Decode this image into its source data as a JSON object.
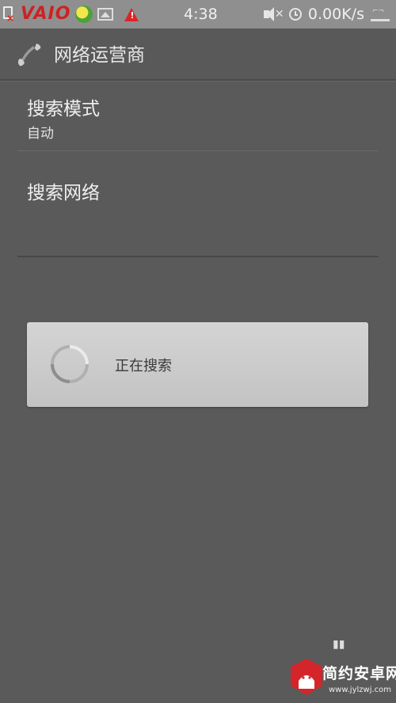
{
  "status_bar": {
    "brand": "VAIO",
    "time": "4:38",
    "net_speed": "0.00K/s",
    "icons": [
      "sim-error-icon",
      "ball-app-icon",
      "image-icon",
      "warning-icon",
      "mute-icon",
      "alarm-clock-icon",
      "network-icon"
    ]
  },
  "header": {
    "title": "网络运营商",
    "icon": "phone-icon"
  },
  "settings": {
    "items": [
      {
        "title": "搜索模式",
        "summary": "自动"
      },
      {
        "title": "搜索网络"
      }
    ]
  },
  "dialog": {
    "message": "正在搜索",
    "icon": "spinner-icon"
  },
  "watermark": {
    "name": "简约安卓网",
    "url": "www.jylzwj.com"
  },
  "colors": {
    "background": "#5a5a5a",
    "status_bar": "#8f8f8f",
    "dialog": "#cccccc",
    "warning": "#d8262a",
    "watermark_red": "#d4262a"
  }
}
